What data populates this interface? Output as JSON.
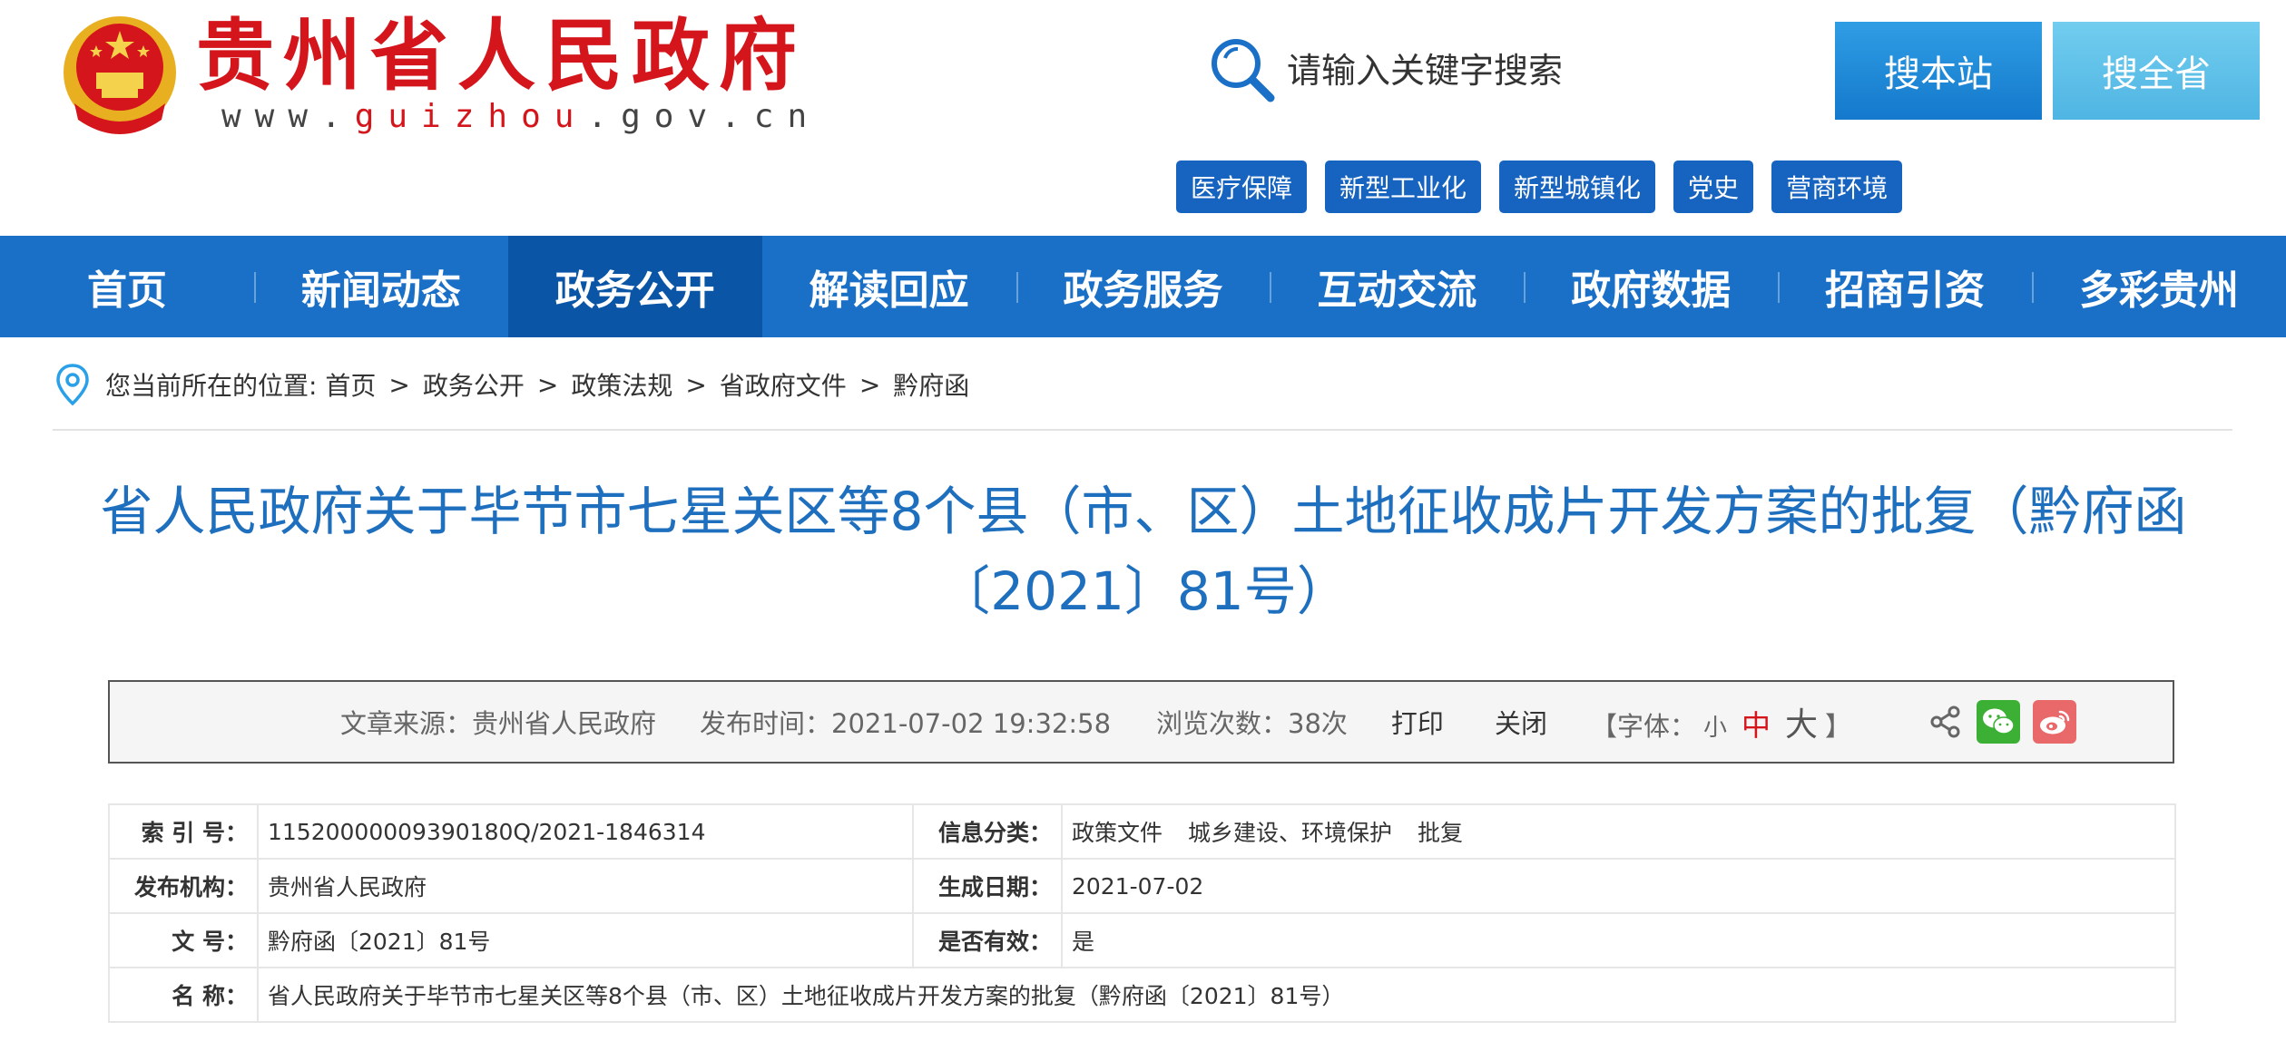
{
  "header": {
    "site_title": "贵州省人民政府",
    "site_url_prefix": "www.",
    "site_url_highlight": "guizhou",
    "site_url_suffix": ".gov.cn",
    "search_placeholder": "请输入关键字搜索",
    "search_site_label": "搜本站",
    "search_province_label": "搜全省",
    "hot_tags": [
      "医疗保障",
      "新型工业化",
      "新型城镇化",
      "党史",
      "营商环境"
    ],
    "colors": {
      "title_red": "#d4161c",
      "nav_blue": "#1a6fc7",
      "tag_blue": "#1663c0"
    }
  },
  "nav": {
    "items": [
      "首页",
      "新闻动态",
      "政务公开",
      "解读回应",
      "政务服务",
      "互动交流",
      "政府数据",
      "招商引资",
      "多彩贵州"
    ],
    "active": "政务公开"
  },
  "breadcrumb": {
    "prefix": "您当前所在的位置:",
    "items": [
      "首页",
      "政务公开",
      "政策法规",
      "省政府文件",
      "黔府函"
    ],
    "separator": ">"
  },
  "document": {
    "title": "省人民政府关于毕节市七星关区等8个县（市、区）土地征收成片开发方案的批复（黔府函〔2021〕81号）"
  },
  "info_bar": {
    "source": "文章来源：贵州省人民政府",
    "publish_time": "发布时间：2021-07-02 19:32:58",
    "views": "浏览次数：38次",
    "print_label": "打印",
    "close_label": "关闭",
    "font_prefix": "【字体：",
    "font_small": "小",
    "font_medium": "中",
    "font_large": "大",
    "font_suffix": "】"
  },
  "meta": {
    "index_label": "索 引 号：",
    "index_value": "11520000009390180Q/2021-1846314",
    "category_label": "信息分类：",
    "category_values": [
      "政策文件",
      "城乡建设、环境保护",
      "批复"
    ],
    "publisher_label": "发布机构：",
    "publisher_value": "贵州省人民政府",
    "date_label": "生成日期：",
    "date_value": "2021-07-02",
    "docno_label": "文 号：",
    "docno_value": "黔府函〔2021〕81号",
    "valid_label": "是否有效：",
    "valid_value": "是",
    "name_label": "名 称：",
    "name_value": "省人民政府关于毕节市七星关区等8个县（市、区）土地征收成片开发方案的批复（黔府函〔2021〕81号）"
  }
}
